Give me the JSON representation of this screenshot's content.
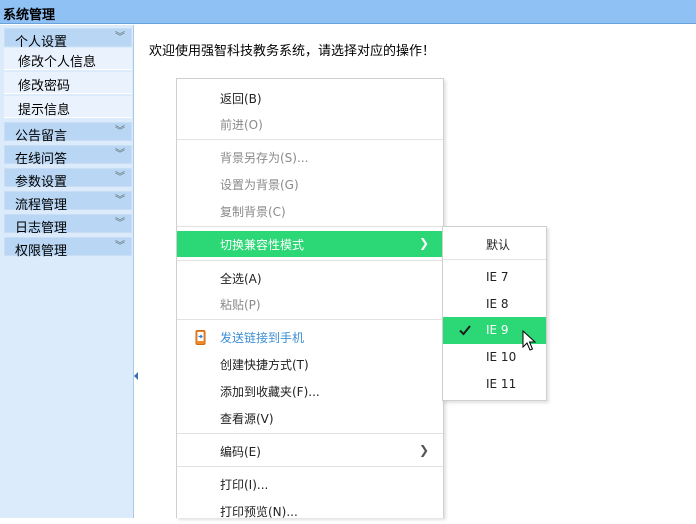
{
  "window": {
    "title": "系统管理"
  },
  "sidebar": {
    "sections": [
      {
        "label": "个人设置",
        "expanded": true,
        "items": [
          "修改个人信息",
          "修改密码",
          "提示信息"
        ]
      },
      {
        "label": "公告留言"
      },
      {
        "label": "在线问答"
      },
      {
        "label": "参数设置"
      },
      {
        "label": "流程管理"
      },
      {
        "label": "日志管理"
      },
      {
        "label": "权限管理"
      }
    ],
    "chevron": "chevron-down-icon"
  },
  "main": {
    "welcome": "欢迎使用强智科技教务系统，请选择对应的操作！"
  },
  "context_menu": {
    "items": [
      {
        "label": "返回(B)",
        "enabled": true
      },
      {
        "label": "前进(O)",
        "enabled": false
      },
      {
        "label": "背景另存为(S)...",
        "enabled": false
      },
      {
        "label": "设置为背景(G)",
        "enabled": false
      },
      {
        "label": "复制背景(C)",
        "enabled": false
      },
      {
        "label": "切换兼容性模式",
        "enabled": true,
        "highlighted": true,
        "has_submenu": true
      },
      {
        "label": "全选(A)",
        "enabled": true
      },
      {
        "label": "粘贴(P)",
        "enabled": false
      },
      {
        "label": "发送链接到手机",
        "enabled": true,
        "icon": "phone-send-icon"
      },
      {
        "label": "创建快捷方式(T)",
        "enabled": true
      },
      {
        "label": "添加到收藏夹(F)...",
        "enabled": true
      },
      {
        "label": "查看源(V)",
        "enabled": true
      },
      {
        "label": "编码(E)",
        "enabled": true,
        "has_submenu": true
      },
      {
        "label": "打印(I)...",
        "enabled": true
      },
      {
        "label": "打印预览(N)...",
        "enabled": true
      }
    ]
  },
  "compat_submenu": {
    "items": [
      {
        "label": "默认"
      },
      {
        "label": "IE 7"
      },
      {
        "label": "IE 8"
      },
      {
        "label": "IE 9",
        "checked": true,
        "highlighted": true
      },
      {
        "label": "IE 10"
      },
      {
        "label": "IE 11"
      }
    ]
  },
  "colors": {
    "titlebar": "#8fc1f5",
    "sidebar": "#dcebfb",
    "section": "#b9d6f4",
    "highlight": "#2cd776",
    "link": "#3b8fd6"
  }
}
